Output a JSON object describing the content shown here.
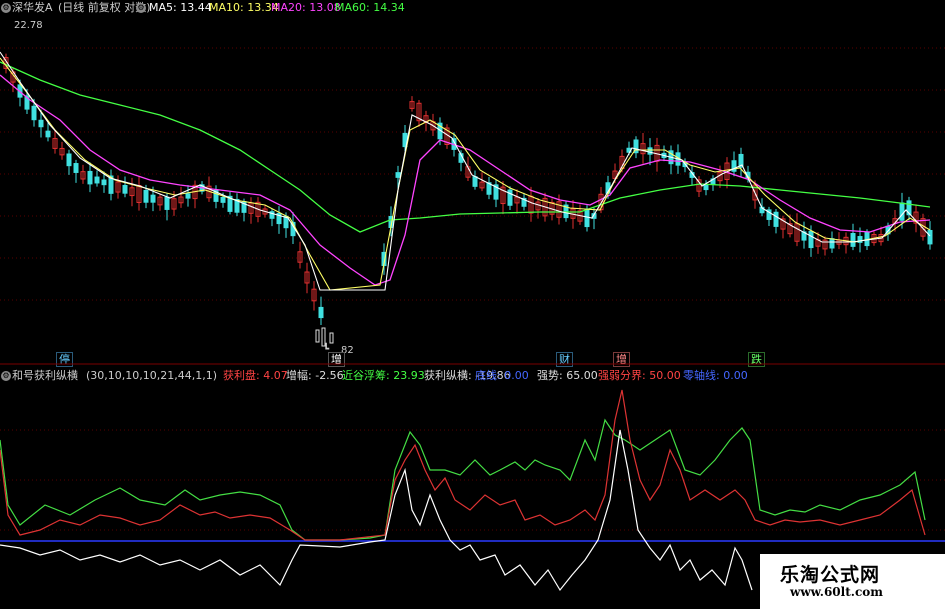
{
  "main_panel": {
    "stock_title": "深华发A",
    "period_info": "(日线 前复权 对数)",
    "ma5_label": "MA5:",
    "ma5_value": "13.44",
    "ma10_label": "MA10:",
    "ma10_value": "13.34",
    "ma20_label": "MA20:",
    "ma20_value": "13.08",
    "ma60_label": "MA60:",
    "ma60_value": "14.34",
    "high_price": "22.78",
    "low_price": "82",
    "low_mark_prefix": "┗",
    "colors": {
      "ma5": "#ffffff",
      "ma10": "#ffff66",
      "ma20": "#ff44ff",
      "ma60": "#44ff44"
    }
  },
  "event_tags": [
    {
      "text": "停",
      "color": "#66ccff"
    },
    {
      "text": "增",
      "color": "#ffffff"
    },
    {
      "text": "财",
      "color": "#66ccff"
    },
    {
      "text": "增",
      "color": "#ff8888"
    },
    {
      "text": "跌",
      "color": "#66ff66"
    }
  ],
  "indicator_panel": {
    "name": "和号获利纵横",
    "params": "(30,10,10,10,21,44,1,1)",
    "items": [
      {
        "label": "获利盘:",
        "value": "4.07",
        "color": "#ff4444"
      },
      {
        "label": "增幅:",
        "value": "-2.56",
        "color": "#dddddd"
      },
      {
        "label": "近谷浮筹:",
        "value": "23.93",
        "color": "#44ff44"
      },
      {
        "label": "获利纵横:",
        "value": "-19.86",
        "color": "#dddddd"
      },
      {
        "label": "底线:",
        "value": "0.00",
        "color": "#4466ff"
      },
      {
        "label": "强势:",
        "value": "65.00",
        "color": "#dddddd"
      },
      {
        "label": "强弱分界:",
        "value": "50.00",
        "color": "#ff4444"
      },
      {
        "label": "零轴线:",
        "value": "0.00",
        "color": "#4466ff"
      }
    ]
  },
  "watermark": {
    "line1": "乐淘公式网",
    "line2": "www.60lt.com"
  }
}
